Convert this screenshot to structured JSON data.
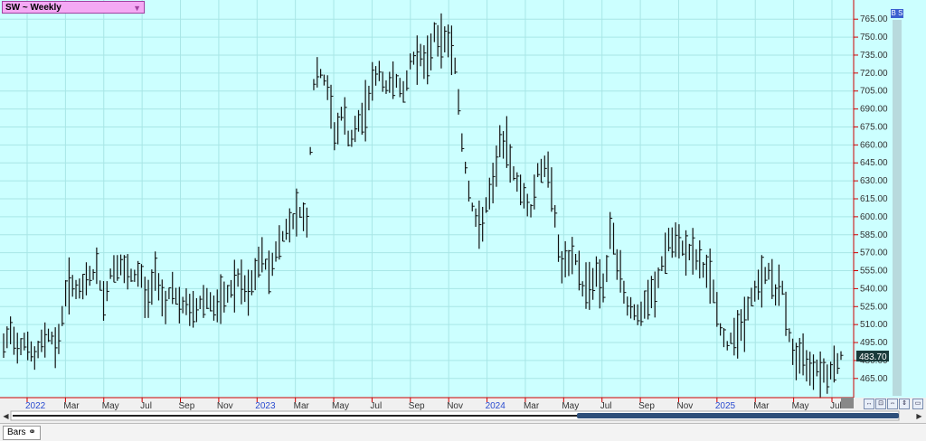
{
  "symbol_label": "SW ~ Weekly",
  "bs_badge": "B S",
  "bottom_tab": "Bars",
  "colors": {
    "background": "#ccffff",
    "grid": "#a8e6e6",
    "bars": "#111111",
    "axis_line": "#cc0000",
    "price_box": "#1a3a3a"
  },
  "chart_data": {
    "type": "ohlc-bar",
    "title": "SW ~ Weekly",
    "y_ticks": [
      465.0,
      480.0,
      495.0,
      510.0,
      525.0,
      540.0,
      555.0,
      570.0,
      585.0,
      600.0,
      615.0,
      630.0,
      645.0,
      660.0,
      675.0,
      690.0,
      705.0,
      720.0,
      735.0,
      750.0,
      765.0
    ],
    "y_tick_labels": [
      "465.00",
      "480.00",
      "495.00",
      "510.00",
      "525.00",
      "540.00",
      "555.00",
      "570.00",
      "585.00",
      "600.00",
      "615.00",
      "630.00",
      "645.00",
      "660.00",
      "675.00",
      "690.00",
      "705.00",
      "720.00",
      "735.00",
      "750.00",
      "765.00"
    ],
    "ylim": [
      449,
      781
    ],
    "current_price": "483.70",
    "x_labels": [
      {
        "text": "2022",
        "year": true
      },
      {
        "text": "Mar"
      },
      {
        "text": "May"
      },
      {
        "text": "Jul"
      },
      {
        "text": "Sep"
      },
      {
        "text": "Nov"
      },
      {
        "text": "2023",
        "year": true
      },
      {
        "text": "Mar"
      },
      {
        "text": "May"
      },
      {
        "text": "Jul"
      },
      {
        "text": "Sep"
      },
      {
        "text": "Nov"
      },
      {
        "text": "2024",
        "year": true
      },
      {
        "text": "Mar"
      },
      {
        "text": "May"
      },
      {
        "text": "Jul"
      },
      {
        "text": "Sep"
      },
      {
        "text": "Nov"
      },
      {
        "text": "2025",
        "year": true
      },
      {
        "text": "Mar"
      },
      {
        "text": "May"
      },
      {
        "text": "Jul"
      }
    ],
    "close_path": [
      [
        0,
        490
      ],
      [
        4,
        505
      ],
      [
        8,
        492
      ],
      [
        12,
        498
      ],
      [
        17,
        480
      ],
      [
        22,
        498
      ],
      [
        26,
        503
      ],
      [
        30,
        487
      ],
      [
        34,
        535
      ],
      [
        38,
        545
      ],
      [
        43,
        535
      ],
      [
        47,
        550
      ],
      [
        52,
        555
      ],
      [
        56,
        528
      ],
      [
        60,
        555
      ],
      [
        64,
        560
      ],
      [
        68,
        553
      ],
      [
        72,
        548
      ],
      [
        76,
        555
      ],
      [
        80,
        527
      ],
      [
        85,
        555
      ],
      [
        90,
        525
      ],
      [
        94,
        545
      ],
      [
        98,
        522
      ],
      [
        102,
        528
      ],
      [
        106,
        518
      ],
      [
        110,
        530
      ],
      [
        114,
        533
      ],
      [
        118,
        522
      ],
      [
        122,
        528
      ],
      [
        126,
        538
      ],
      [
        131,
        548
      ],
      [
        136,
        533
      ],
      [
        140,
        550
      ],
      [
        144,
        568
      ],
      [
        148,
        553
      ],
      [
        152,
        572
      ],
      [
        157,
        588
      ],
      [
        161,
        598
      ],
      [
        165,
        605
      ],
      [
        169,
        595
      ],
      [
        173,
        712
      ],
      [
        177,
        720
      ],
      [
        181,
        705
      ],
      [
        185,
        665
      ],
      [
        189,
        690
      ],
      [
        193,
        660
      ],
      [
        197,
        675
      ],
      [
        201,
        685
      ],
      [
        206,
        715
      ],
      [
        210,
        720
      ],
      [
        214,
        705
      ],
      [
        218,
        720
      ],
      [
        223,
        700
      ],
      [
        227,
        730
      ],
      [
        232,
        738
      ],
      [
        236,
        722
      ],
      [
        240,
        755
      ],
      [
        244,
        745
      ],
      [
        248,
        750
      ],
      [
        252,
        725
      ],
      [
        256,
        655
      ],
      [
        261,
        610
      ],
      [
        265,
        588
      ],
      [
        269,
        608
      ],
      [
        273,
        625
      ],
      [
        277,
        665
      ],
      [
        281,
        655
      ],
      [
        286,
        630
      ],
      [
        290,
        618
      ],
      [
        294,
        605
      ],
      [
        298,
        640
      ],
      [
        302,
        640
      ],
      [
        306,
        628
      ],
      [
        310,
        560
      ],
      [
        315,
        560
      ],
      [
        319,
        565
      ],
      [
        323,
        540
      ],
      [
        327,
        545
      ],
      [
        331,
        552
      ],
      [
        335,
        540
      ],
      [
        339,
        592
      ],
      [
        343,
        555
      ],
      [
        347,
        530
      ],
      [
        351,
        522
      ],
      [
        355,
        515
      ],
      [
        359,
        530
      ],
      [
        363,
        535
      ],
      [
        367,
        560
      ],
      [
        371,
        580
      ],
      [
        375,
        575
      ],
      [
        379,
        575
      ],
      [
        383,
        570
      ],
      [
        387,
        563
      ],
      [
        391,
        555
      ],
      [
        395,
        548
      ],
      [
        399,
        510
      ],
      [
        403,
        490
      ],
      [
        407,
        505
      ],
      [
        411,
        505
      ],
      [
        415,
        523
      ],
      [
        419,
        538
      ],
      [
        423,
        548
      ],
      [
        427,
        555
      ],
      [
        431,
        535
      ],
      [
        435,
        540
      ],
      [
        439,
        490
      ],
      [
        443,
        480
      ],
      [
        447,
        480
      ],
      [
        451,
        475
      ],
      [
        455,
        475
      ],
      [
        459,
        468
      ],
      [
        463,
        476
      ],
      [
        467,
        483.7
      ]
    ],
    "n_bars": 244,
    "note": "weekly high/low/close bars, Jan 2022 - Jul 2025"
  }
}
